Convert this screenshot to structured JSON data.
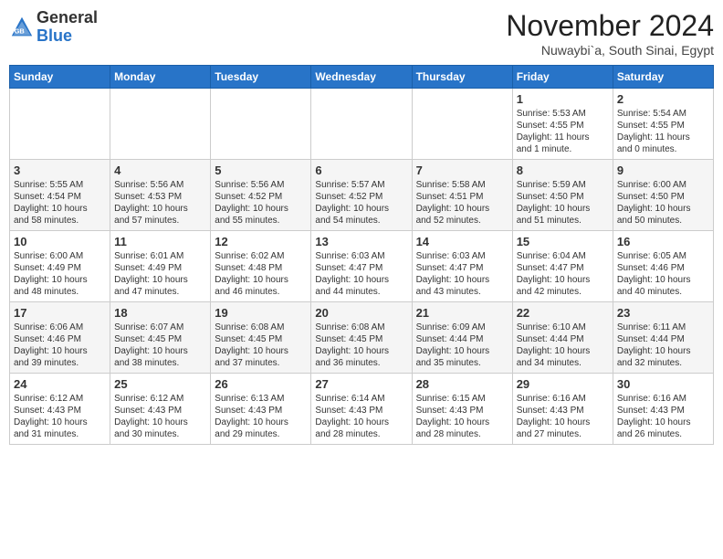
{
  "header": {
    "logo_general": "General",
    "logo_blue": "Blue",
    "month_title": "November 2024",
    "location": "Nuwaybi`a, South Sinai, Egypt"
  },
  "days_of_week": [
    "Sunday",
    "Monday",
    "Tuesday",
    "Wednesday",
    "Thursday",
    "Friday",
    "Saturday"
  ],
  "weeks": [
    {
      "cells": [
        {
          "day": "",
          "info": ""
        },
        {
          "day": "",
          "info": ""
        },
        {
          "day": "",
          "info": ""
        },
        {
          "day": "",
          "info": ""
        },
        {
          "day": "",
          "info": ""
        },
        {
          "day": "1",
          "info": "Sunrise: 5:53 AM\nSunset: 4:55 PM\nDaylight: 11 hours\nand 1 minute."
        },
        {
          "day": "2",
          "info": "Sunrise: 5:54 AM\nSunset: 4:55 PM\nDaylight: 11 hours\nand 0 minutes."
        }
      ]
    },
    {
      "cells": [
        {
          "day": "3",
          "info": "Sunrise: 5:55 AM\nSunset: 4:54 PM\nDaylight: 10 hours\nand 58 minutes."
        },
        {
          "day": "4",
          "info": "Sunrise: 5:56 AM\nSunset: 4:53 PM\nDaylight: 10 hours\nand 57 minutes."
        },
        {
          "day": "5",
          "info": "Sunrise: 5:56 AM\nSunset: 4:52 PM\nDaylight: 10 hours\nand 55 minutes."
        },
        {
          "day": "6",
          "info": "Sunrise: 5:57 AM\nSunset: 4:52 PM\nDaylight: 10 hours\nand 54 minutes."
        },
        {
          "day": "7",
          "info": "Sunrise: 5:58 AM\nSunset: 4:51 PM\nDaylight: 10 hours\nand 52 minutes."
        },
        {
          "day": "8",
          "info": "Sunrise: 5:59 AM\nSunset: 4:50 PM\nDaylight: 10 hours\nand 51 minutes."
        },
        {
          "day": "9",
          "info": "Sunrise: 6:00 AM\nSunset: 4:50 PM\nDaylight: 10 hours\nand 50 minutes."
        }
      ]
    },
    {
      "cells": [
        {
          "day": "10",
          "info": "Sunrise: 6:00 AM\nSunset: 4:49 PM\nDaylight: 10 hours\nand 48 minutes."
        },
        {
          "day": "11",
          "info": "Sunrise: 6:01 AM\nSunset: 4:49 PM\nDaylight: 10 hours\nand 47 minutes."
        },
        {
          "day": "12",
          "info": "Sunrise: 6:02 AM\nSunset: 4:48 PM\nDaylight: 10 hours\nand 46 minutes."
        },
        {
          "day": "13",
          "info": "Sunrise: 6:03 AM\nSunset: 4:47 PM\nDaylight: 10 hours\nand 44 minutes."
        },
        {
          "day": "14",
          "info": "Sunrise: 6:03 AM\nSunset: 4:47 PM\nDaylight: 10 hours\nand 43 minutes."
        },
        {
          "day": "15",
          "info": "Sunrise: 6:04 AM\nSunset: 4:47 PM\nDaylight: 10 hours\nand 42 minutes."
        },
        {
          "day": "16",
          "info": "Sunrise: 6:05 AM\nSunset: 4:46 PM\nDaylight: 10 hours\nand 40 minutes."
        }
      ]
    },
    {
      "cells": [
        {
          "day": "17",
          "info": "Sunrise: 6:06 AM\nSunset: 4:46 PM\nDaylight: 10 hours\nand 39 minutes."
        },
        {
          "day": "18",
          "info": "Sunrise: 6:07 AM\nSunset: 4:45 PM\nDaylight: 10 hours\nand 38 minutes."
        },
        {
          "day": "19",
          "info": "Sunrise: 6:08 AM\nSunset: 4:45 PM\nDaylight: 10 hours\nand 37 minutes."
        },
        {
          "day": "20",
          "info": "Sunrise: 6:08 AM\nSunset: 4:45 PM\nDaylight: 10 hours\nand 36 minutes."
        },
        {
          "day": "21",
          "info": "Sunrise: 6:09 AM\nSunset: 4:44 PM\nDaylight: 10 hours\nand 35 minutes."
        },
        {
          "day": "22",
          "info": "Sunrise: 6:10 AM\nSunset: 4:44 PM\nDaylight: 10 hours\nand 34 minutes."
        },
        {
          "day": "23",
          "info": "Sunrise: 6:11 AM\nSunset: 4:44 PM\nDaylight: 10 hours\nand 32 minutes."
        }
      ]
    },
    {
      "cells": [
        {
          "day": "24",
          "info": "Sunrise: 6:12 AM\nSunset: 4:43 PM\nDaylight: 10 hours\nand 31 minutes."
        },
        {
          "day": "25",
          "info": "Sunrise: 6:12 AM\nSunset: 4:43 PM\nDaylight: 10 hours\nand 30 minutes."
        },
        {
          "day": "26",
          "info": "Sunrise: 6:13 AM\nSunset: 4:43 PM\nDaylight: 10 hours\nand 29 minutes."
        },
        {
          "day": "27",
          "info": "Sunrise: 6:14 AM\nSunset: 4:43 PM\nDaylight: 10 hours\nand 28 minutes."
        },
        {
          "day": "28",
          "info": "Sunrise: 6:15 AM\nSunset: 4:43 PM\nDaylight: 10 hours\nand 28 minutes."
        },
        {
          "day": "29",
          "info": "Sunrise: 6:16 AM\nSunset: 4:43 PM\nDaylight: 10 hours\nand 27 minutes."
        },
        {
          "day": "30",
          "info": "Sunrise: 6:16 AM\nSunset: 4:43 PM\nDaylight: 10 hours\nand 26 minutes."
        }
      ]
    }
  ]
}
